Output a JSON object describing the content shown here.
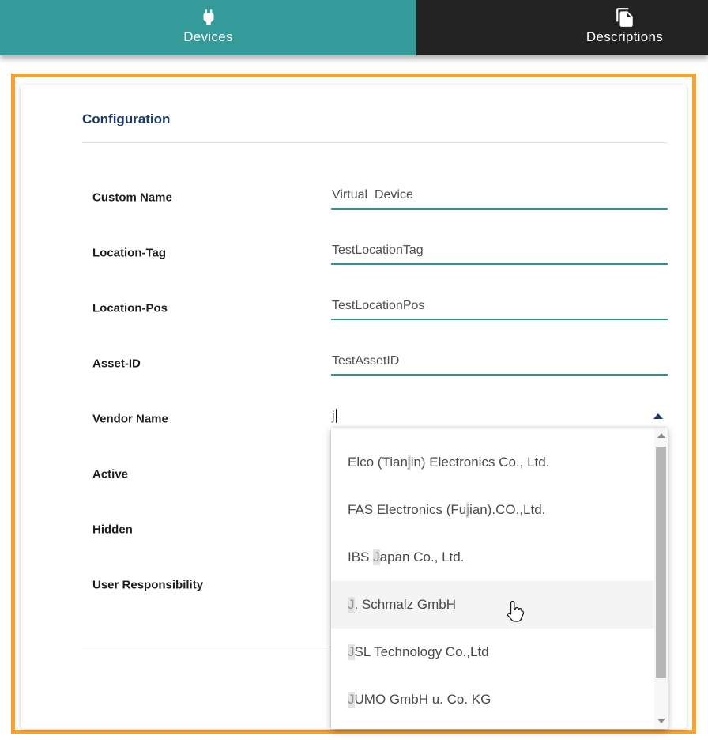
{
  "tabs": [
    {
      "label": "Devices",
      "icon": "plug-icon",
      "active": true
    },
    {
      "label": "Descriptions",
      "icon": "copy-icon",
      "active": false
    }
  ],
  "colors": {
    "tab_active_bg": "#359a9a",
    "tab_inactive_bg": "#232323",
    "frame_border": "#f7a12e",
    "title_color": "#1b3a6b",
    "input_underline": "#2f9594"
  },
  "panel": {
    "title": "Configuration"
  },
  "fields": [
    {
      "label": "Custom Name",
      "value": "Virtual  Device"
    },
    {
      "label": "Location-Tag",
      "value": "TestLocationTag"
    },
    {
      "label": "Location-Pos",
      "value": "TestLocationPos"
    },
    {
      "label": "Asset-ID",
      "value": "TestAssetID"
    },
    {
      "label": "Vendor Name",
      "value": "j"
    },
    {
      "label": "Active"
    },
    {
      "label": "Hidden"
    },
    {
      "label": "User Responsibility"
    }
  ],
  "dropdown": {
    "options": [
      {
        "pre": "Elco (Tian",
        "match": "j",
        "post": "in) Electronics Co., Ltd."
      },
      {
        "pre": "FAS Electronics (Fu",
        "match": "j",
        "post": "ian).CO.,Ltd."
      },
      {
        "pre": "IBS ",
        "match": "J",
        "post": "apan Co., Ltd."
      },
      {
        "pre": "",
        "match": "J",
        "post": ". Schmalz GmbH",
        "hovered": true
      },
      {
        "pre": "",
        "match": "J",
        "post": "SL Technology Co.,Ltd"
      },
      {
        "pre": "",
        "match": "J",
        "post": "UMO GmbH u. Co. KG"
      }
    ]
  }
}
